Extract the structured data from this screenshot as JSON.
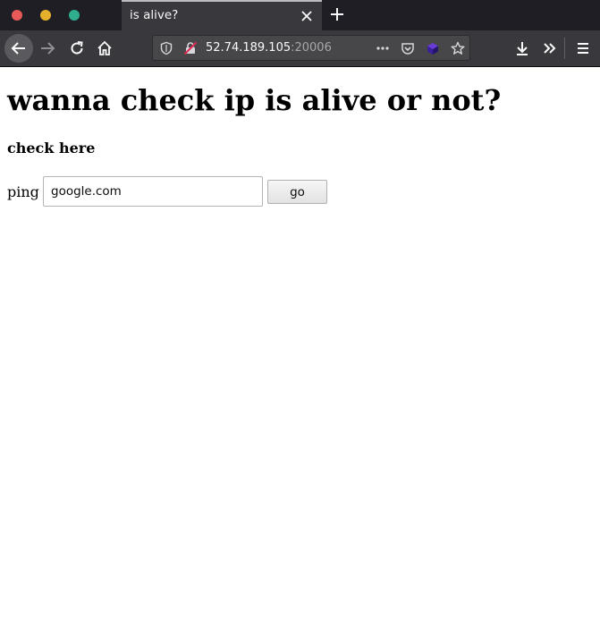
{
  "browser": {
    "tab_title": "is alive?",
    "url_host": "52.74.189.105",
    "url_port": ":20006",
    "icons": [
      "back-icon",
      "forward-icon",
      "reload-icon",
      "home-icon",
      "shield-icon",
      "insecure-lock-icon",
      "more-icon",
      "pocket-icon",
      "extension-icon",
      "star-icon",
      "download-icon",
      "overflow-icon",
      "menu-icon",
      "close-icon",
      "plus-icon"
    ]
  },
  "page": {
    "heading": "wanna check ip is alive or not?",
    "subheading": "check here",
    "form": {
      "label": "ping",
      "input_value": "google.com",
      "button_label": "go"
    }
  }
}
